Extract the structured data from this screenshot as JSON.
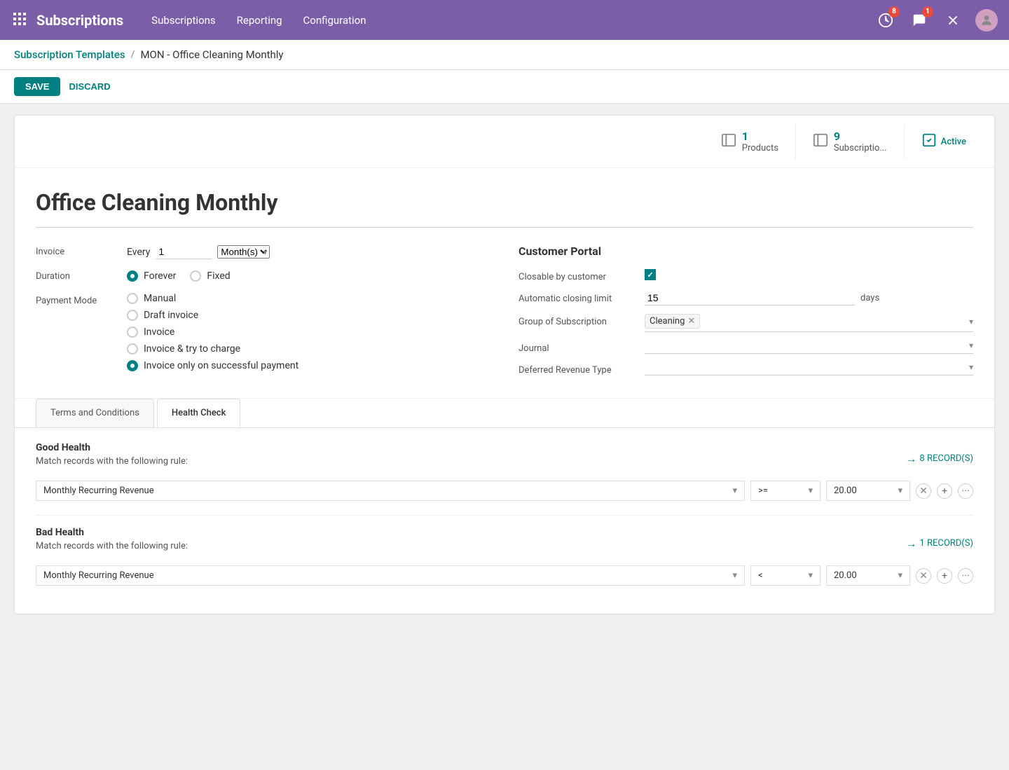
{
  "nav": {
    "app_name": "Subscriptions",
    "links": [
      "Subscriptions",
      "Reporting",
      "Configuration"
    ],
    "badge_clock": "8",
    "badge_chat": "1"
  },
  "breadcrumb": {
    "parent": "Subscription Templates",
    "separator": "/",
    "current": "MON - Office Cleaning Monthly"
  },
  "toolbar": {
    "save_label": "SAVE",
    "discard_label": "DISCARD"
  },
  "stats": {
    "products_count": "1",
    "products_label": "Products",
    "subscriptions_count": "9",
    "subscriptions_label": "Subscriptio...",
    "active_label": "Active"
  },
  "form": {
    "title": "Office Cleaning Monthly",
    "invoice_label": "Invoice",
    "invoice_every": "Every",
    "invoice_value": "1",
    "invoice_period": "Month(s)",
    "duration_label": "Duration",
    "duration_forever": "Forever",
    "duration_fixed": "Fixed",
    "payment_mode_label": "Payment Mode",
    "payment_options": [
      "Manual",
      "Draft invoice",
      "Invoice",
      "Invoice & try to charge",
      "Invoice only on successful payment"
    ],
    "payment_selected": "Invoice only on successful payment"
  },
  "customer_portal": {
    "title": "Customer Portal",
    "closable_label": "Closable by customer",
    "auto_closing_label": "Automatic closing limit",
    "auto_closing_value": "15",
    "auto_closing_unit": "days",
    "group_label": "Group of Subscription",
    "group_tag": "Cleaning",
    "journal_label": "Journal",
    "deferred_label": "Deferred Revenue Type"
  },
  "tabs": {
    "terms_label": "Terms and Conditions",
    "health_label": "Health Check"
  },
  "health_check": {
    "good_title": "Good Health",
    "good_desc": "Match records with the following rule:",
    "good_records": "8 RECORD(S)",
    "good_field": "Monthly Recurring Revenue",
    "good_op": ">=",
    "good_value": "20.00",
    "bad_title": "Bad Health",
    "bad_desc": "Match records with the following rule:",
    "bad_records": "1 RECORD(S)",
    "bad_field": "Monthly Recurring Revenue",
    "bad_op": "<",
    "bad_value": "20.00"
  }
}
